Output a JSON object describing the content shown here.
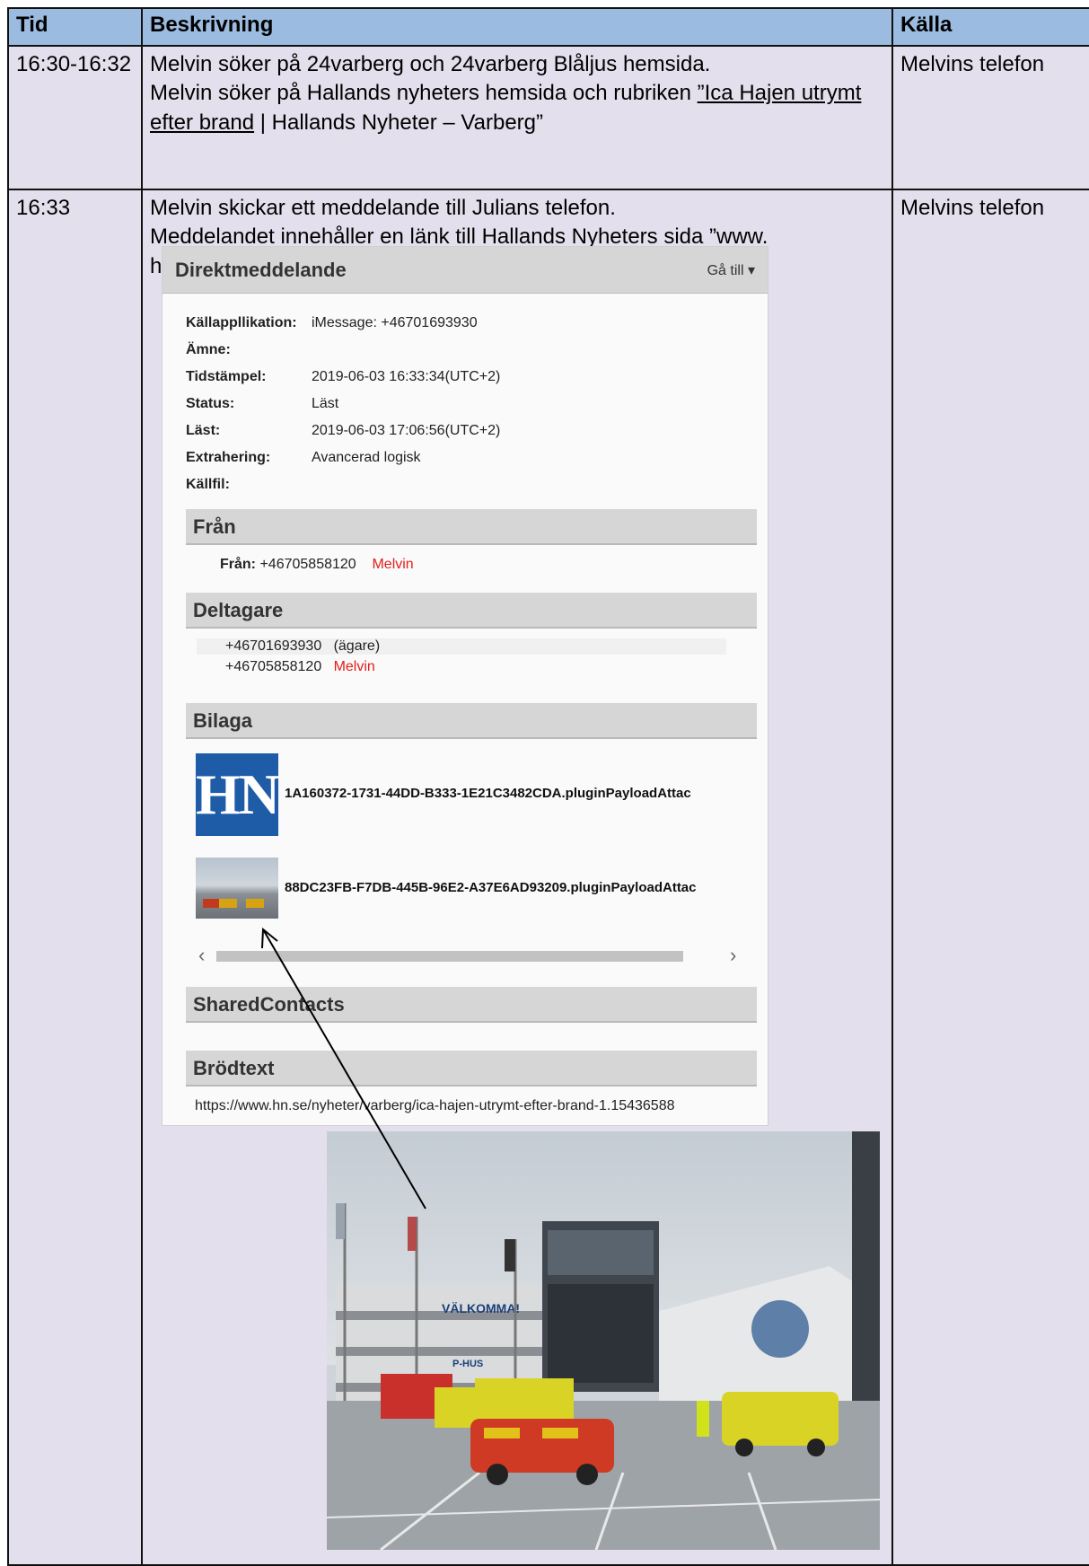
{
  "table": {
    "headers": {
      "tid": "Tid",
      "beskrivning": "Beskrivning",
      "kalla": "Källa"
    },
    "rows": [
      {
        "tid": "16:30-16:32",
        "line1": "Melvin söker på 24varberg och 24varberg Blåljus hemsida.",
        "line2_prefix": "Melvin söker på Hallands nyheters hemsida och rubriken ",
        "line2_link": "”Ica Hajen utrymt efter brand",
        "line2_suffix": " | Hallands Nyheter – Varberg”",
        "kalla": "Melvins telefon"
      },
      {
        "tid": "16:33",
        "line1": "Melvin skickar ett meddelande till Julians telefon.",
        "line2": "Meddelandet innehåller en länk till Hallands Nyheters sida ”www. hn.se/nyheter/Varberg/ica-hajen-utrymt-efter-brand”.",
        "kalla": "Melvins telefon"
      }
    ]
  },
  "message": {
    "title": "Direktmeddelande",
    "goto": "Gå till",
    "fields": [
      {
        "key": "Källappllikation:",
        "value": "iMessage: +46701693930"
      },
      {
        "key": "Ämne:",
        "value": ""
      },
      {
        "key": "Tidstämpel:",
        "value": "2019-06-03 16:33:34(UTC+2)"
      },
      {
        "key": "Status:",
        "value": "Läst"
      },
      {
        "key": "Läst:",
        "value": "2019-06-03 17:06:56(UTC+2)"
      },
      {
        "key": "Extrahering:",
        "value": "Avancerad logisk"
      },
      {
        "key": "Källfil:",
        "value": ""
      }
    ],
    "from_section": "Från",
    "from_label": "Från:",
    "from_number": "+46705858120",
    "from_name": "Melvin",
    "participants_section": "Deltagare",
    "participant1_number": "+46701693930",
    "participant1_role": "(ägare)",
    "participant2_number": "+46705858120",
    "participant2_name": "Melvin",
    "attachment_section": "Bilaga",
    "attachment1_logo": "HN",
    "attachment1_name": "1A160372-1731-44DD-B333-1E21C3482CDA.pluginPayloadAttac",
    "attachment2_name": "88DC23FB-F7DB-445B-96E2-A37E6AD93209.pluginPayloadAttac",
    "shared_contacts_section": "SharedContacts",
    "body_section": "Brödtext",
    "body_text": "https://www.hn.se/nyheter/varberg/ica-hajen-utrymt-efter-brand-1.15436588"
  },
  "photo": {
    "sign": "VÄLKOMMA!",
    "phus": "P-HUS"
  }
}
